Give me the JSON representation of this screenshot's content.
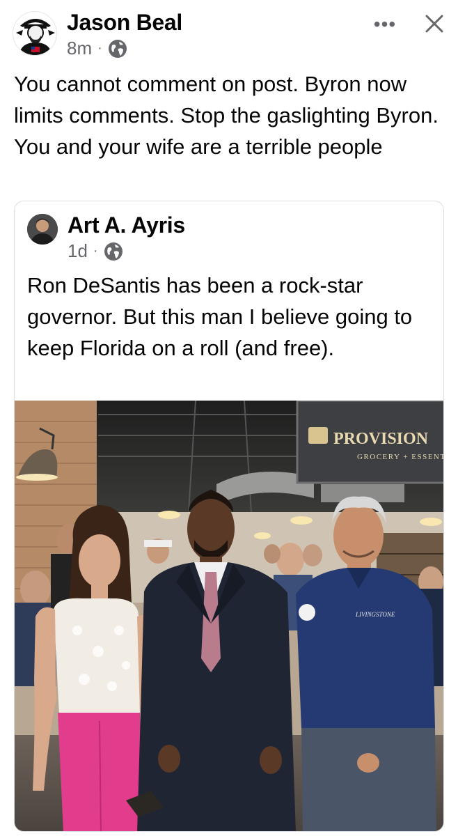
{
  "post": {
    "author": "Jason Beal",
    "time": "8m",
    "separator": "·",
    "text": "You cannot comment on post. Byron now limits comments. Stop the gaslighting Byron. You and your wife are a terrible people",
    "more_label": "•••",
    "close_icon": "close-icon"
  },
  "shared_post": {
    "author": "Art A. Ayris",
    "time": "1d",
    "separator": "·",
    "text": "Ron DeSantis has been a rock-star governor. But this man I believe going to keep Florida on a roll (and free)."
  },
  "photo": {
    "sign_name": "PROVISION",
    "sign_sub": "GROCERY + ESSENT",
    "shirt_logo": "LIVINGSTONE",
    "colors": {
      "brick": "#b58a66",
      "sign_bg": "#3d3f42",
      "sign_text": "#e8d9b0",
      "pink": "#e23c8c",
      "navy_shirt": "#253a72",
      "suit": "#1f2533"
    }
  }
}
